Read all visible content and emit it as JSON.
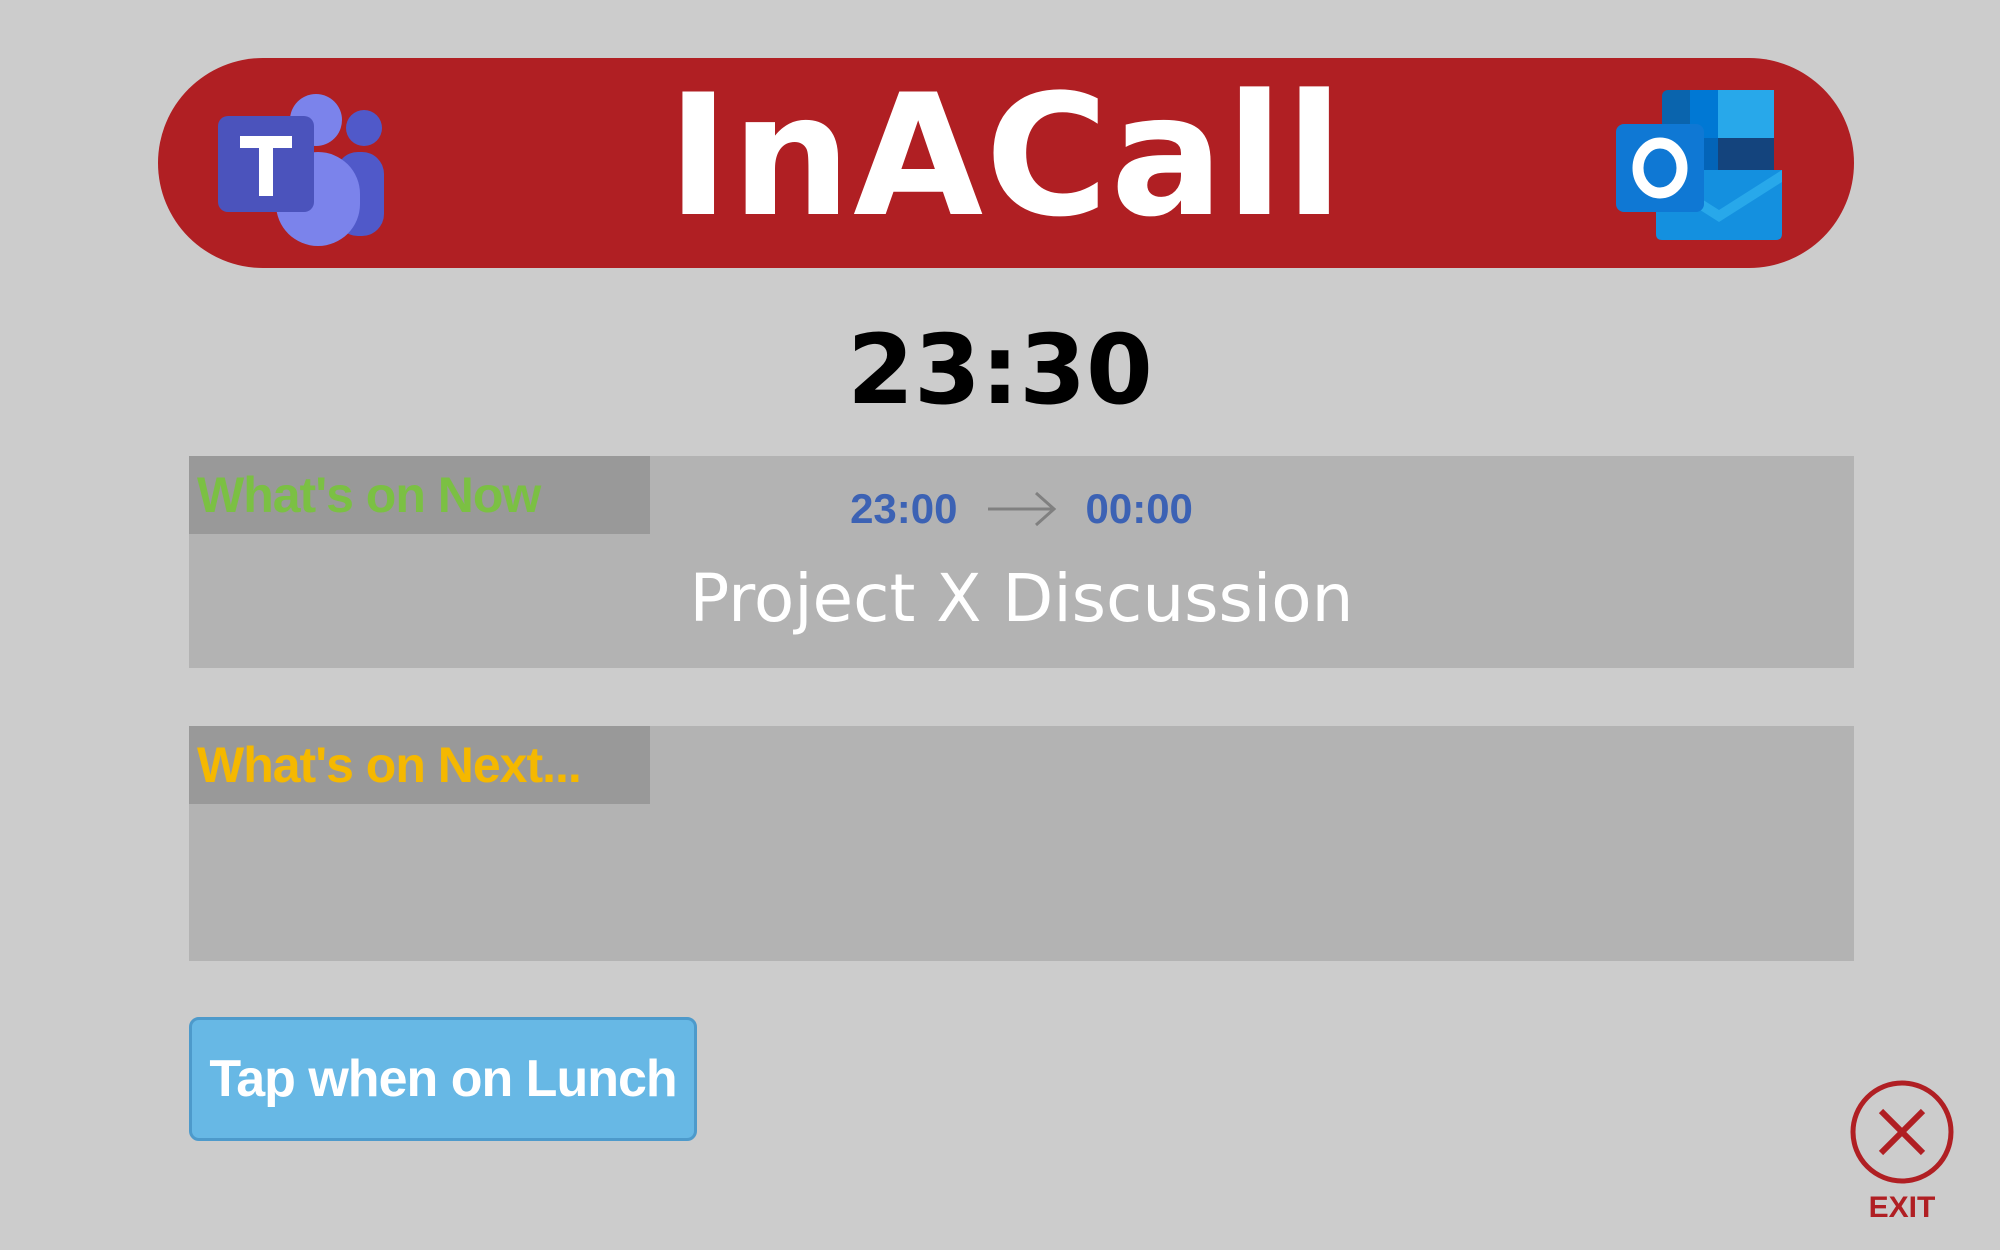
{
  "header": {
    "title": "InACall",
    "left_icon": "microsoft-teams-logo",
    "right_icon": "microsoft-outlook-logo",
    "color": "#b01f23"
  },
  "clock": {
    "time": "23:30"
  },
  "now_panel": {
    "label": "What's on Now",
    "label_color": "#7bc043",
    "start_time": "23:00",
    "end_time": "00:00",
    "event_title": "Project X Discussion"
  },
  "next_panel": {
    "label": "What's on Next...",
    "label_color": "#f5b800"
  },
  "lunch_button": {
    "label": "Tap when on Lunch",
    "color": "#67b8e5"
  },
  "exit_button": {
    "label": "EXIT",
    "icon": "close-circle-icon",
    "color": "#b01f23"
  }
}
